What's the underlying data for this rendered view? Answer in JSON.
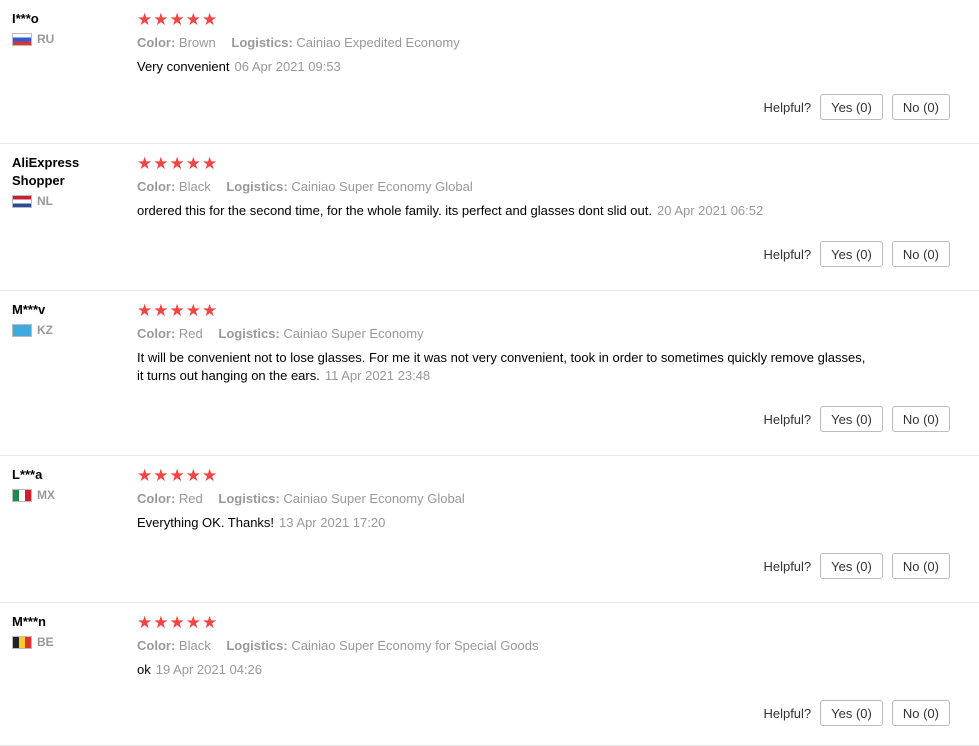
{
  "reviews": [
    {
      "name": "I***o",
      "country": "RU",
      "flag_stripes": [
        "#ffffff",
        "#2b5bd7",
        "#e03030"
      ],
      "flag_dir": "horizontal",
      "stars": "★★★★★",
      "color_label": "Color:",
      "color_value": "Brown",
      "logistics_label": "Logistics:",
      "logistics_value": "Cainiao Expedited Economy",
      "text": "Very convenient",
      "date": "06 Apr 2021 09:53",
      "helpful_label": "Helpful?",
      "yes_label": "Yes (0)",
      "no_label": "No (0)"
    },
    {
      "name": "AliExpress Shopper",
      "country": "NL",
      "flag_stripes": [
        "#c8202f",
        "#ffffff",
        "#2a4a9b"
      ],
      "flag_dir": "horizontal",
      "stars": "★★★★★",
      "color_label": "Color:",
      "color_value": "Black",
      "logistics_label": "Logistics:",
      "logistics_value": "Cainiao Super Economy Global",
      "text": "ordered this for the second time, for the whole family. its perfect and glasses dont slid out.",
      "date": "20 Apr 2021 06:52",
      "helpful_label": "Helpful?",
      "yes_label": "Yes (0)",
      "no_label": "No (0)"
    },
    {
      "name": "M***v",
      "country": "KZ",
      "flag_stripes": [
        "#3fa9e0",
        "#3fa9e0",
        "#3fa9e0"
      ],
      "flag_dir": "horizontal",
      "stars": "★★★★★",
      "color_label": "Color:",
      "color_value": "Red",
      "logistics_label": "Logistics:",
      "logistics_value": "Cainiao Super Economy",
      "text": "It will be convenient not to lose glasses. For me it was not very convenient, took in order to sometimes quickly remove glasses, it turns out hanging on the ears.",
      "date": "11 Apr 2021 23:48",
      "helpful_label": "Helpful?",
      "yes_label": "Yes (0)",
      "no_label": "No (0)"
    },
    {
      "name": "L***a",
      "country": "MX",
      "flag_stripes": [
        "#1f8a4c",
        "#ffffff",
        "#d0202e"
      ],
      "flag_dir": "vertical",
      "stars": "★★★★★",
      "color_label": "Color:",
      "color_value": "Red",
      "logistics_label": "Logistics:",
      "logistics_value": "Cainiao Super Economy Global",
      "text": "Everything OK. Thanks!",
      "date": "13 Apr 2021 17:20",
      "helpful_label": "Helpful?",
      "yes_label": "Yes (0)",
      "no_label": "No (0)"
    },
    {
      "name": "M***n",
      "country": "BE",
      "flag_stripes": [
        "#222222",
        "#f5d020",
        "#e03030"
      ],
      "flag_dir": "vertical",
      "stars": "★★★★★",
      "color_label": "Color:",
      "color_value": "Black",
      "logistics_label": "Logistics:",
      "logistics_value": "Cainiao Super Economy for Special Goods",
      "text": "ok",
      "date": "19 Apr 2021 04:26",
      "helpful_label": "Helpful?",
      "yes_label": "Yes (0)",
      "no_label": "No (0)"
    }
  ]
}
